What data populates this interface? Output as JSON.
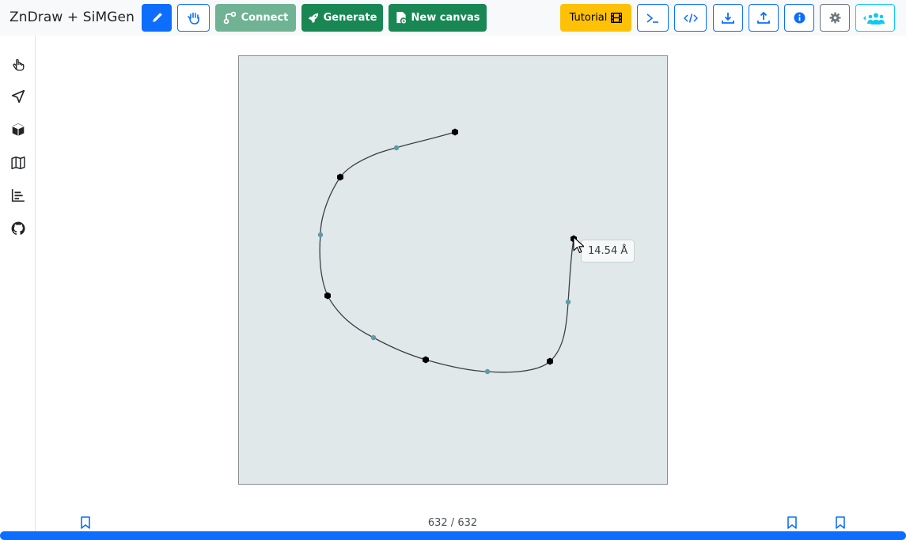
{
  "app": {
    "title": "ZnDraw + SiMGen"
  },
  "toolbar": {
    "draw_icon": "pencil-icon",
    "interact_icon": "hand-icon",
    "connect": {
      "label": "Connect",
      "icon": "connect-nodes-icon"
    },
    "generate": {
      "label": "Generate",
      "icon": "rocket-icon"
    },
    "new_canvas": {
      "label": "New canvas",
      "icon": "new-file-icon"
    },
    "tutorial": {
      "label": "Tutorial",
      "icon": "film-icon"
    },
    "right_icons": [
      "terminal-icon",
      "code-icon",
      "download-icon",
      "upload-icon",
      "info-icon",
      "gear-icon",
      "users-icon"
    ]
  },
  "sidebar": {
    "items": [
      "pointer-hand-icon",
      "navigate-icon",
      "cube-icon",
      "map-icon",
      "chart-icon",
      "github-icon"
    ]
  },
  "canvas": {
    "background_color": "#e0e8ea",
    "curve_color": "#3a4045",
    "anchor_color": "#000000",
    "control_color": "#5f9aa7",
    "distance_label": "14.54 Å"
  },
  "timeline": {
    "frame_current": 632,
    "frame_total": 632,
    "frame_text": "632 / 632",
    "progress_fraction": 1.0,
    "progress_color": "#0d6efd",
    "bookmark_count": 3
  }
}
